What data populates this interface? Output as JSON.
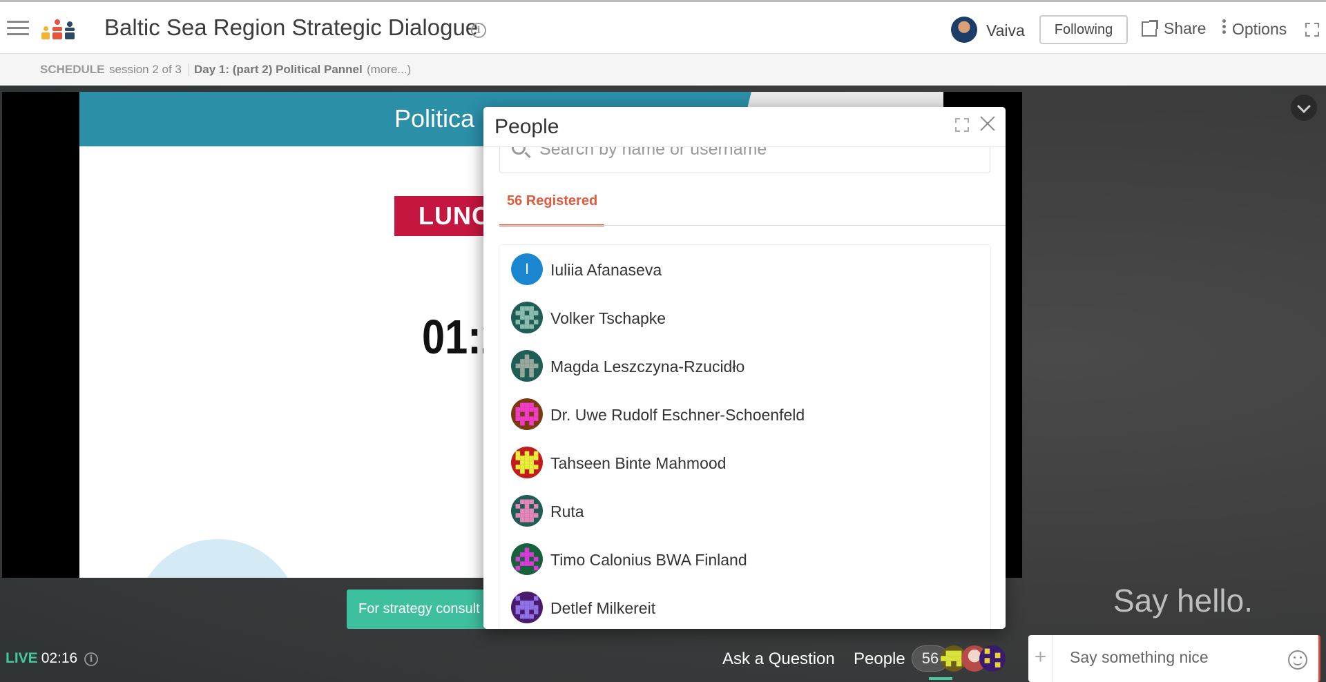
{
  "app": {
    "title": "Baltic Sea Region Strategic Dialogue",
    "user_name": "Vaiva",
    "following_label": "Following",
    "share_label": "Share",
    "options_label": "Options"
  },
  "schedule": {
    "label": "SCHEDULE",
    "session": "session 2 of 3",
    "session_title": "Day 1: (part 2) Political Pannel",
    "more": "(more...)"
  },
  "slide": {
    "title": "Politica",
    "lunch": "LUNC",
    "timer": "01:2"
  },
  "banner": {
    "text": "For strategy consult"
  },
  "stage": {
    "say_hello": "Say hello."
  },
  "footer": {
    "live_label": "LIVE",
    "live_time": "02:16",
    "ask_question": "Ask a Question",
    "people_label": "People",
    "people_count": "56"
  },
  "chat": {
    "placeholder": "Say something nice"
  },
  "people_modal": {
    "title": "People",
    "search_placeholder": "Search by name or username",
    "tab_registered": "56 Registered",
    "people": [
      {
        "name": "Iuliia Afanaseva",
        "initial": "I",
        "avatar_bg": "#1a86d0"
      },
      {
        "name": "Volker Tschapke",
        "avatar_bg": "#1e5e55",
        "avatar_fg": "#8cbcae"
      },
      {
        "name": "Magda Leszczyna-Rzucidło",
        "avatar_bg": "#1e5e55",
        "avatar_fg": "#9aa79c"
      },
      {
        "name": "Dr. Uwe Rudolf Eschner-Schoenfeld",
        "avatar_bg": "#7a3a10",
        "avatar_fg": "#f23cc8"
      },
      {
        "name": "Tahseen Binte Mahmood",
        "avatar_bg": "#c21b1b",
        "avatar_fg": "#e6f03a"
      },
      {
        "name": "Ruta",
        "avatar_bg": "#1e5e55",
        "avatar_fg": "#e586b8"
      },
      {
        "name": "Timo Calonius BWA Finland",
        "avatar_bg": "#17613b",
        "avatar_fg": "#d93ad9"
      },
      {
        "name": "Detlef Milkereit",
        "avatar_bg": "#4a1a6e",
        "avatar_fg": "#8f73e6"
      }
    ]
  },
  "colors": {
    "accent_orange": "#e05a3d",
    "live_green": "#43c9a0",
    "banner_green": "#3ebf9e",
    "slide_header": "#2b8fa8",
    "lunch_red": "#c4163f"
  },
  "icons": [
    "menu-icon",
    "logo-icon",
    "info-icon",
    "share-icon",
    "more-vertical-icon",
    "fullscreen-icon",
    "chevron-down-icon",
    "search-icon",
    "close-icon",
    "expand-icon",
    "plus-icon",
    "emoji-icon"
  ]
}
